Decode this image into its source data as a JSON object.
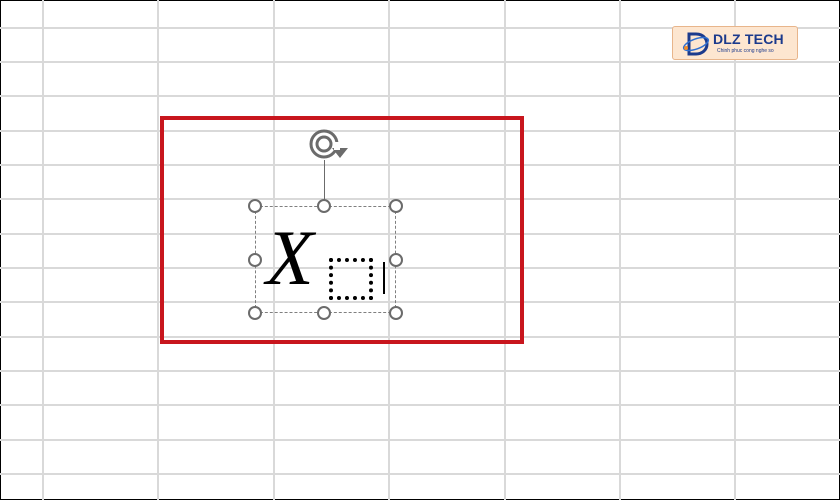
{
  "logo": {
    "name": "DLZ TECH",
    "tagline": "Chinh phuc cong nghe so"
  },
  "equation": {
    "variable": "X"
  },
  "colors": {
    "highlight": "#c8161d",
    "gridline": "#d9d9d9",
    "handle": "#6b6b6b",
    "logo_bg": "#fde6d0",
    "logo_text": "#1b3a8c"
  },
  "icons": {
    "rotate": "rotate-handle-icon",
    "logo_mark": "dlz-logo-mark-icon"
  }
}
